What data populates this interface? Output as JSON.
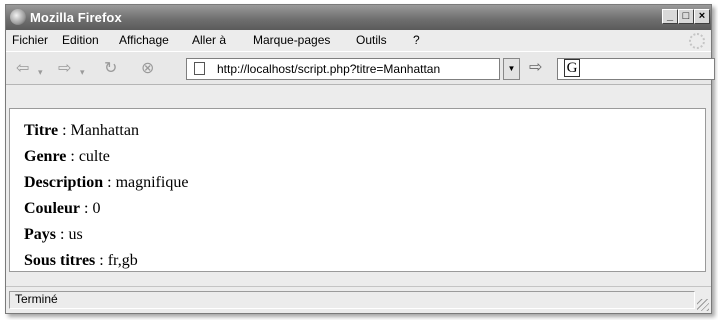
{
  "window": {
    "title": "Mozilla Firefox",
    "controls": {
      "minimize": "_",
      "maximize": "□",
      "close": "×"
    }
  },
  "menubar": {
    "items": [
      "Fichier",
      "Edition",
      "Affichage",
      "Aller à",
      "Marque-pages",
      "Outils",
      "?"
    ]
  },
  "navbar": {
    "icons": [
      "back-arrow-icon",
      "forward-arrow-icon",
      "reload-icon",
      "stop-icon",
      "page-icon",
      "go-icon"
    ],
    "url": "http://localhost/script.php?titre=Manhattan",
    "search_engine": "G"
  },
  "page": {
    "fields": [
      {
        "label": "Titre",
        "value": "Manhattan"
      },
      {
        "label": "Genre",
        "value": "culte"
      },
      {
        "label": "Description",
        "value": "magnifique"
      },
      {
        "label": "Couleur",
        "value": "0"
      },
      {
        "label": "Pays",
        "value": "us"
      },
      {
        "label": "Sous titres",
        "value": "fr,gb"
      }
    ],
    "separator": " : "
  },
  "status": {
    "text": "Terminé"
  }
}
